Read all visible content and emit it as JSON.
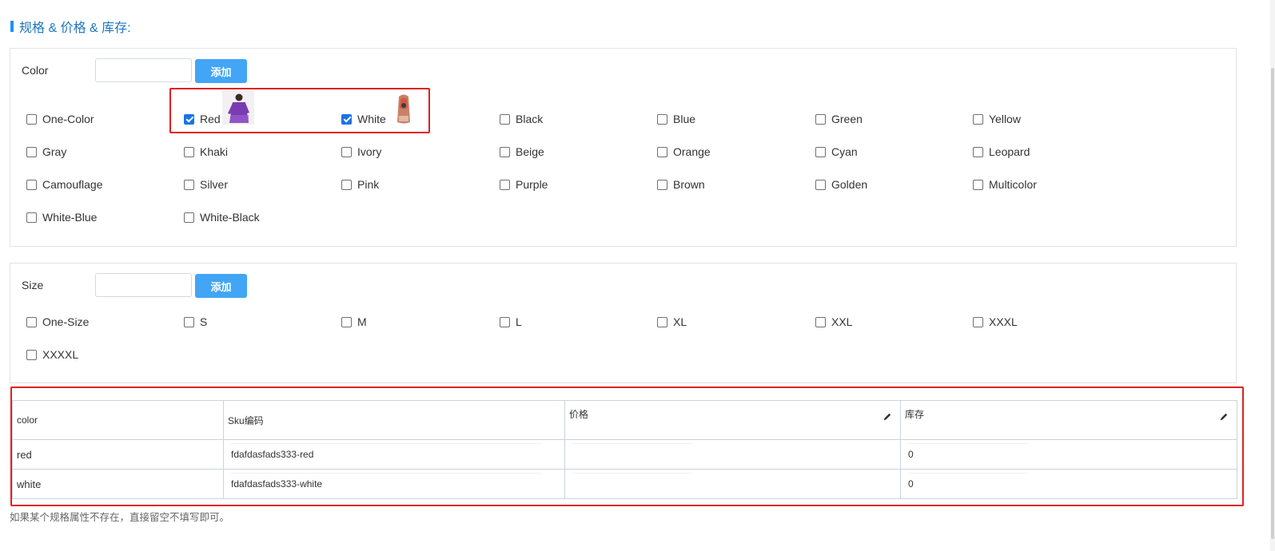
{
  "section_title": "规格 & 价格 & 库存:",
  "color_panel": {
    "label": "Color",
    "input_value": "",
    "add_label": "添加",
    "options": [
      {
        "label": "One-Color",
        "checked": false
      },
      {
        "label": "Red",
        "checked": true
      },
      {
        "label": "White",
        "checked": true
      },
      {
        "label": "Black",
        "checked": false
      },
      {
        "label": "Blue",
        "checked": false
      },
      {
        "label": "Green",
        "checked": false
      },
      {
        "label": "Yellow",
        "checked": false
      },
      {
        "label": "Gray",
        "checked": false
      },
      {
        "label": "Khaki",
        "checked": false
      },
      {
        "label": "Ivory",
        "checked": false
      },
      {
        "label": "Beige",
        "checked": false
      },
      {
        "label": "Orange",
        "checked": false
      },
      {
        "label": "Cyan",
        "checked": false
      },
      {
        "label": "Leopard",
        "checked": false
      },
      {
        "label": "Camouflage",
        "checked": false
      },
      {
        "label": "Silver",
        "checked": false
      },
      {
        "label": "Pink",
        "checked": false
      },
      {
        "label": "Purple",
        "checked": false
      },
      {
        "label": "Brown",
        "checked": false
      },
      {
        "label": "Golden",
        "checked": false
      },
      {
        "label": "Multicolor",
        "checked": false
      },
      {
        "label": "White-Blue",
        "checked": false
      },
      {
        "label": "White-Black",
        "checked": false
      }
    ]
  },
  "size_panel": {
    "label": "Size",
    "input_value": "",
    "add_label": "添加",
    "options": [
      {
        "label": "One-Size",
        "checked": false
      },
      {
        "label": "S",
        "checked": false
      },
      {
        "label": "M",
        "checked": false
      },
      {
        "label": "L",
        "checked": false
      },
      {
        "label": "XL",
        "checked": false
      },
      {
        "label": "XXL",
        "checked": false
      },
      {
        "label": "XXXL",
        "checked": false
      },
      {
        "label": "XXXXL",
        "checked": false
      }
    ]
  },
  "sku_table": {
    "headers": [
      "color",
      "Sku编码",
      "价格",
      "库存"
    ],
    "rows": [
      {
        "color": "red",
        "sku": "fdafdasfads333-red",
        "price": "",
        "stock": "0"
      },
      {
        "color": "white",
        "sku": "fdafdasfads333-white",
        "price": "",
        "stock": "0"
      }
    ]
  },
  "note": "如果某个规格属性不存在，直接留空不填写即可。",
  "colors": {
    "accent": "#42a5f5",
    "title": "#1e76bd",
    "highlight": "#e02020",
    "checkbox_checked": "#1a73e8"
  }
}
